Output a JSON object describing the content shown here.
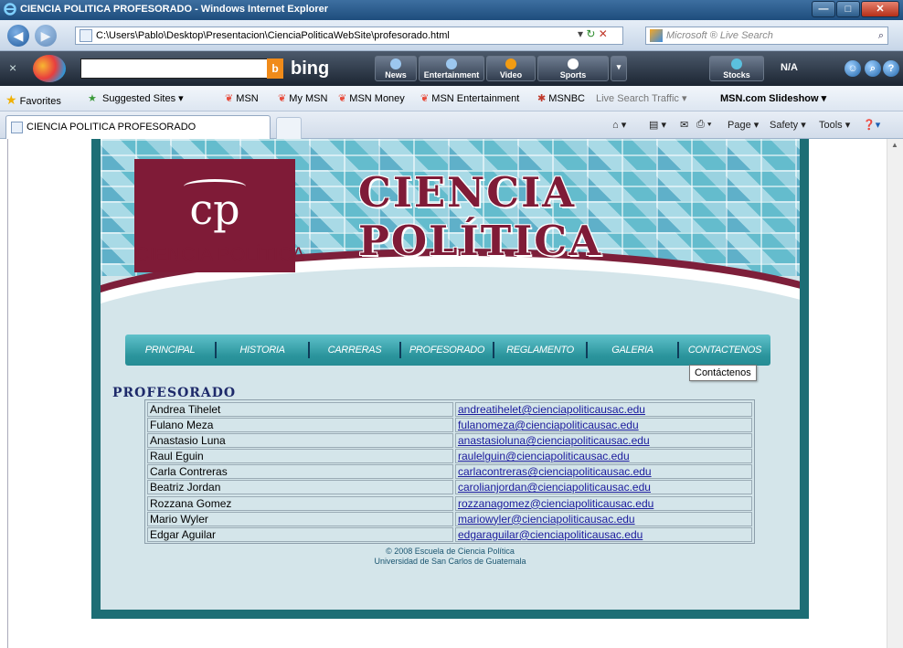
{
  "window": {
    "title": "CIENCIA POLITICA PROFESORADO - Windows Internet Explorer",
    "controls": {
      "minimize": "—",
      "maximize": "□",
      "close": "✕"
    }
  },
  "addressbar": {
    "back": "◀",
    "forward": "▶",
    "url": "C:\\Users\\Pablo\\Desktop\\Presentacion\\CienciaPoliticaWebSite\\profesorado.html",
    "go_icon": "↻",
    "stop_icon": "✕",
    "search_placeholder": "Microsoft ® Live Search",
    "search_icon": "⌕"
  },
  "msn_toolbar": {
    "close": "×",
    "search_value": "",
    "bing_label": "bing",
    "buttons": [
      "News",
      "Entertainment",
      "Video",
      "Sports",
      "Stocks"
    ],
    "stock_value": "N/A",
    "more": "▾"
  },
  "favorites": {
    "label": "Favorites",
    "items": [
      "Suggested Sites ▾",
      "MSN",
      "My MSN",
      "MSN Money",
      "MSN Entertainment",
      "MSNBC",
      "Live Search Traffic ▾",
      "MSN.com Slideshow ▾"
    ]
  },
  "tabs": {
    "active": "CIENCIA POLITICA PROFESORADO",
    "commands": [
      "Page ▾",
      "Safety ▾",
      "Tools ▾"
    ]
  },
  "site": {
    "logo_monogram": "cp",
    "logo_text": "CIENCIA POLÍTICA",
    "banner_title": "CIENCIA POLÍTICA",
    "menu": [
      "PRINCIPAL",
      "HISTORIA",
      "CARRERAS",
      "PROFESORADO",
      "REGLAMENTO",
      "GALERIA",
      "CONTACTENOS"
    ],
    "tooltip": "Contáctenos",
    "section_title": "PROFESORADO",
    "professors": [
      {
        "name": "Andrea Tihelet",
        "email": "andreatihelet@cienciapoliticausac.edu"
      },
      {
        "name": "Fulano Meza",
        "email": "fulanomeza@cienciapoliticausac.edu"
      },
      {
        "name": "Anastasio Luna",
        "email": "anastasioluna@cienciapoliticausac.edu"
      },
      {
        "name": "Raul Eguin",
        "email": "raulelguin@cienciapoliticausac.edu"
      },
      {
        "name": "Carla Contreras",
        "email": "carlacontreras@cienciapoliticausac.edu"
      },
      {
        "name": "Beatriz Jordan",
        "email": "carolianjordan@cienciapoliticausac.edu"
      },
      {
        "name": "Rozzana Gomez",
        "email": "rozzanagomez@cienciapoliticausac.edu"
      },
      {
        "name": "Mario Wyler",
        "email": "mariowyler@cienciapoliticausac.edu"
      },
      {
        "name": "Edgar Aguilar",
        "email": "edgaraguilar@cienciapoliticausac.edu"
      }
    ],
    "footer_line1": "© 2008 Escuela de Ciencia Política",
    "footer_line2": "Universidad de San Carlos de Guatemala"
  },
  "colors": {
    "brand": "#7f1b37",
    "menu": "#2a949c",
    "frame": "#1d6e75",
    "link": "#1a1a9c"
  }
}
